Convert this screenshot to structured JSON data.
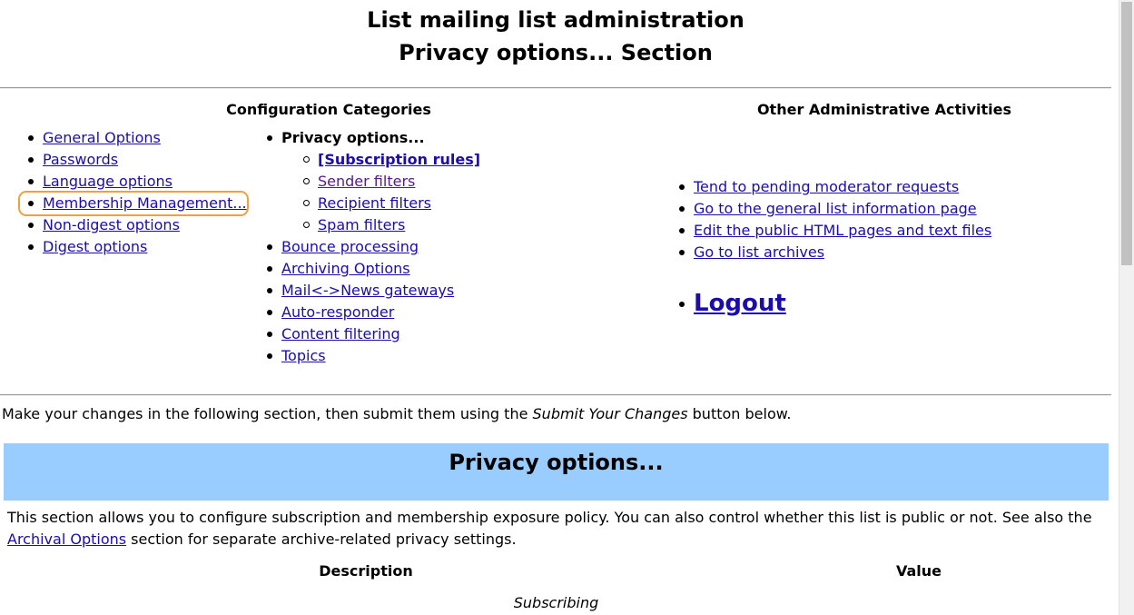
{
  "header": {
    "title_line1": "List mailing list administration",
    "title_line2": "Privacy options... Section"
  },
  "config": {
    "heading": "Configuration Categories",
    "left_items": [
      {
        "label": "General Options"
      },
      {
        "label": "Passwords"
      },
      {
        "label": "Language options"
      },
      {
        "label": "Membership Management..."
      },
      {
        "label": "Non-digest options"
      },
      {
        "label": "Digest options"
      }
    ],
    "current_category": "Privacy options...",
    "sub_items": [
      {
        "label": "[Subscription rules]"
      },
      {
        "label": "Sender filters"
      },
      {
        "label": "Recipient filters"
      },
      {
        "label": "Spam filters"
      }
    ],
    "right_items": [
      {
        "label": "Bounce processing"
      },
      {
        "label": "Archiving Options"
      },
      {
        "label": "Mail<->News gateways"
      },
      {
        "label": "Auto-responder"
      },
      {
        "label": "Content filtering"
      },
      {
        "label": "Topics"
      }
    ]
  },
  "other": {
    "heading": "Other Administrative Activities",
    "items": [
      {
        "label": "Tend to pending moderator requests"
      },
      {
        "label": "Go to the general list information page"
      },
      {
        "label": "Edit the public HTML pages and text files"
      },
      {
        "label": "Go to list archives"
      }
    ],
    "logout": "Logout"
  },
  "instructions": {
    "before": "Make your changes in the following section, then submit them using the ",
    "emphasis": "Submit Your Changes",
    "after": " button below."
  },
  "section": {
    "title": "Privacy options...",
    "desc_before": "This section allows you to configure subscription and membership exposure policy. You can also control whether this list is public or not. See also the ",
    "desc_link": "Archival Options",
    "desc_after": " section for separate archive-related privacy settings.",
    "col_description": "Description",
    "col_value": "Value",
    "subsection": "Subscribing"
  },
  "colors": {
    "banner": "#99ccff",
    "link": "#1a0dab",
    "highlight": "#f0a040"
  }
}
